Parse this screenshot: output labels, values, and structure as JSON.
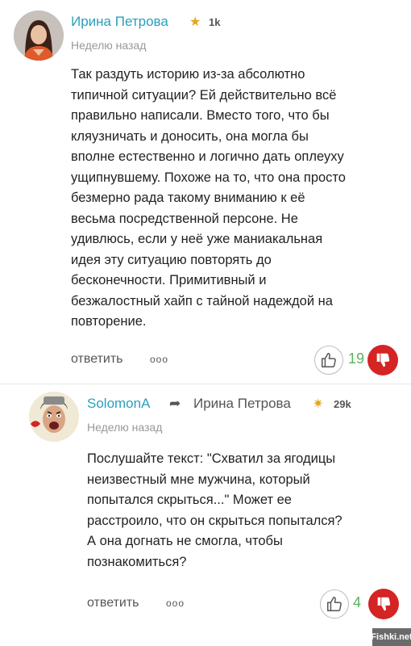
{
  "comments": [
    {
      "author": "Ирина Петрова",
      "rating": "1k",
      "time": "Неделю назад",
      "text": "Так раздуть историю из-за абсолютно\nтипичной ситуации? Ей действительно всё\nправильно написали. Вместо того, что бы\nкляузничать и доносить, она могла бы\nвполне естественно и логично дать оплеуху\nущипнувшему. Похоже на то, что она просто\nбезмерно рада такому вниманию к её\nвесьма посредственной персоне. Не\nудивлюсь, если у неё уже маниакальная\nидея эту ситуацию повторять до\nбесконечности. Примитивный и\nбезжалостный хайп с тайной надеждой на\nповторение.",
      "reply_label": "ответить",
      "more_label": "ооо",
      "score": "19"
    },
    {
      "author": "SolomonA",
      "reply_to": "Ирина Петрова",
      "rating": "29k",
      "time": "Неделю назад",
      "text": "Послушайте текст: \"Схватил за ягодицы\nнеизвестный мне мужчина, который\nпопытался скрыться...\" Может ее\nрасстроило, что он скрыться попытался?\nА она догнать не смогла, чтобы\nпознакомиться?",
      "reply_label": "ответить",
      "more_label": "ооо",
      "score": "4"
    }
  ],
  "watermark": "Fishki.net",
  "colors": {
    "author": "#2a9fbd",
    "score": "#5bb35b",
    "downvote": "#d42424",
    "star": "#e6a71b"
  }
}
